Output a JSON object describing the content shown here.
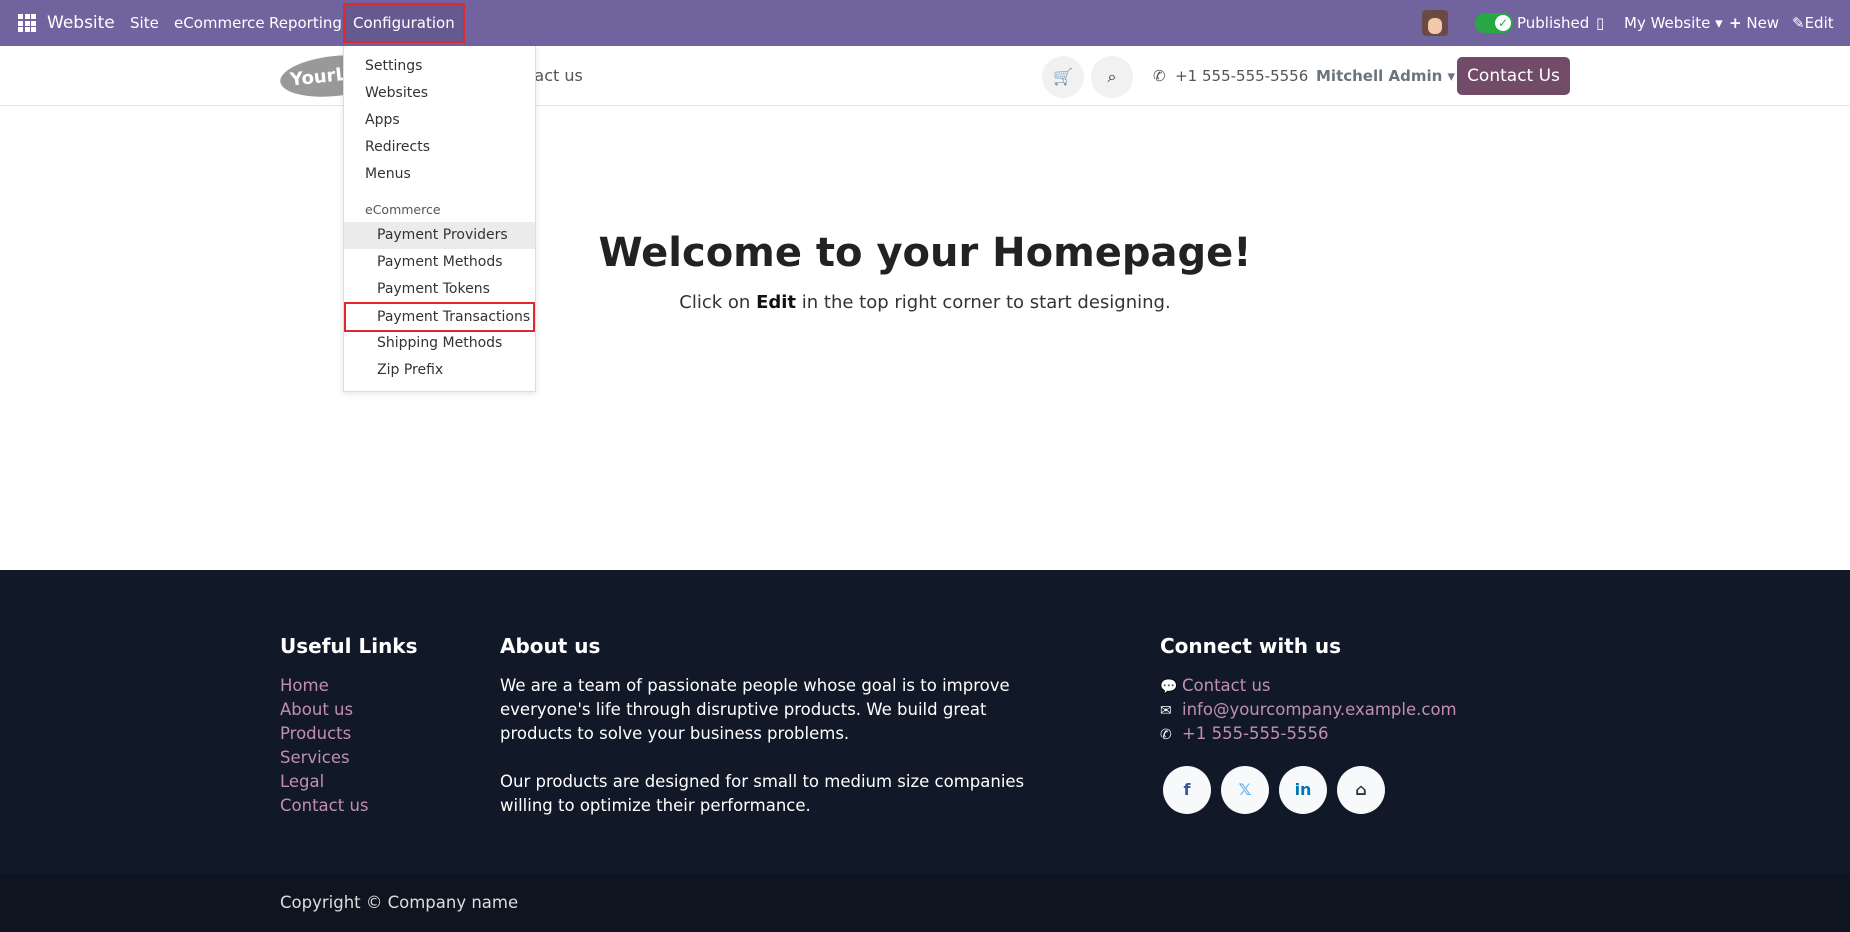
{
  "topbar": {
    "app": "Website",
    "menus": [
      "Site",
      "eCommerce",
      "Reporting",
      "Configuration"
    ],
    "published": "Published",
    "website": "My Website",
    "new": "New",
    "edit": "Edit",
    "accent": "#71639e"
  },
  "header": {
    "logo": "YourLogo",
    "nav_partial": "ntact us",
    "phone": "+1 555-555-5556",
    "user": "Mitchell Admin",
    "contact_button": "Contact Us"
  },
  "dropdown": {
    "items": [
      "Settings",
      "Websites",
      "Apps",
      "Redirects",
      "Menus"
    ],
    "section": "eCommerce",
    "ecommerce_items": [
      "Payment Providers",
      "Payment Methods",
      "Payment Tokens",
      "Payment Transactions",
      "Shipping Methods",
      "Zip Prefix"
    ]
  },
  "main": {
    "title": "Welcome to your Homepage!",
    "sub_pre": "Click on ",
    "sub_bold": "Edit",
    "sub_post": " in the top right corner to start designing."
  },
  "footer": {
    "links_title": "Useful Links",
    "links": [
      "Home",
      "About us",
      "Products",
      "Services",
      "Legal",
      "Contact us"
    ],
    "about_title": "About us",
    "about_p1": "We are a team of passionate people whose goal is to improve everyone's life through disruptive products. We build great products to solve your business problems.",
    "about_p2": "Our products are designed for small to medium size companies willing to optimize their performance.",
    "connect_title": "Connect with us",
    "contact": "Contact us",
    "email": "info@yourcompany.example.com",
    "phone": "+1 555-555-5556",
    "social": [
      "facebook-icon",
      "x-icon",
      "linkedin-icon",
      "home-icon"
    ]
  },
  "copyright": "Copyright © Company name"
}
